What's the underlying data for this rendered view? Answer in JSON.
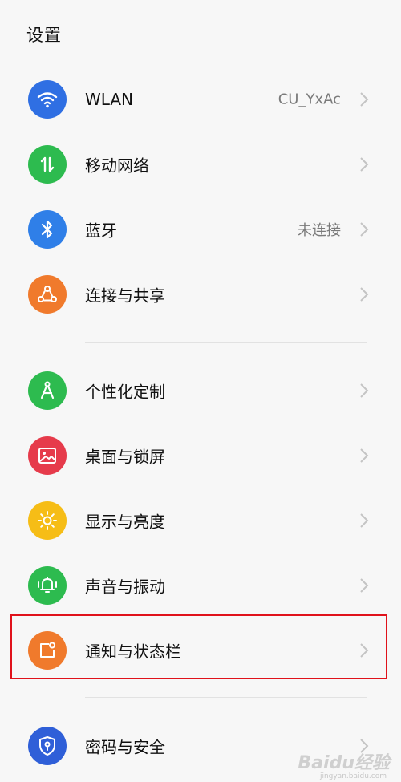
{
  "header": {
    "title": "设置"
  },
  "colors": {
    "wlan": "#2f6fe3",
    "mobile": "#2dbb4f",
    "bluetooth": "#2f7fe8",
    "share": "#f07a2c",
    "personalize": "#2dbb4f",
    "desktop": "#e63b4b",
    "display": "#f6bd16",
    "sound": "#2dbb4f",
    "notify": "#f07a2c",
    "security": "#2f5fd8",
    "highlight": "#e0121b"
  },
  "items": [
    {
      "label": "WLAN",
      "value": "CU_YxAc",
      "icon": "wifi-icon"
    },
    {
      "label": "移动网络",
      "value": "",
      "icon": "mobile-data-icon"
    },
    {
      "label": "蓝牙",
      "value": "未连接",
      "icon": "bluetooth-icon"
    },
    {
      "label": "连接与共享",
      "value": "",
      "icon": "share-icon"
    },
    {
      "label": "个性化定制",
      "value": "",
      "icon": "personalize-icon"
    },
    {
      "label": "桌面与锁屏",
      "value": "",
      "icon": "wallpaper-icon"
    },
    {
      "label": "显示与亮度",
      "value": "",
      "icon": "brightness-icon"
    },
    {
      "label": "声音与振动",
      "value": "",
      "icon": "bell-icon"
    },
    {
      "label": "通知与状态栏",
      "value": "",
      "icon": "notification-icon"
    },
    {
      "label": "密码与安全",
      "value": "",
      "icon": "shield-lock-icon"
    }
  ],
  "watermark": {
    "brand": "Baidu经验",
    "url": "jingyan.baidu.com"
  }
}
